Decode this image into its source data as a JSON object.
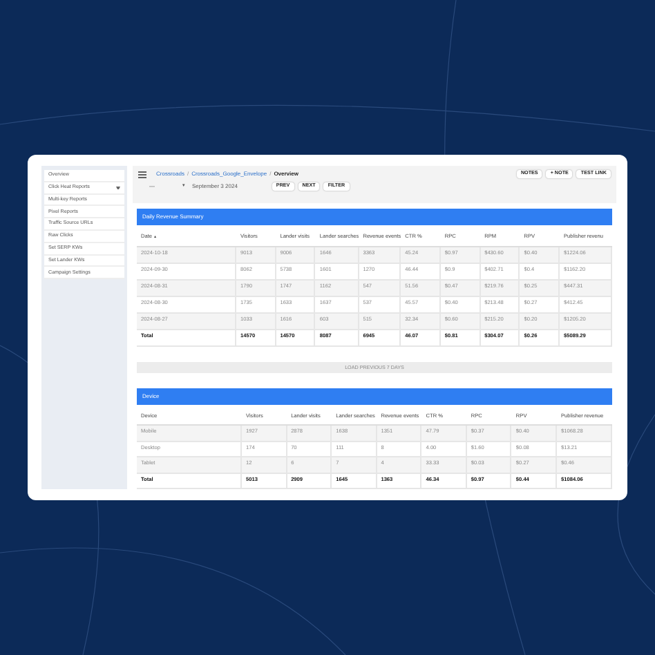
{
  "sidebar": {
    "items": [
      {
        "label": "Overview"
      },
      {
        "label": "Click Heat Reports",
        "expandable": true
      },
      {
        "label": "Multi-key Reports"
      },
      {
        "label": "Pixel Reports"
      },
      {
        "label": "Traffic Source URLs"
      },
      {
        "label": "Raw Clicks"
      },
      {
        "label": "Set SERP KWs"
      },
      {
        "label": "Set Lander KWs"
      },
      {
        "label": "Campaign Settings"
      }
    ]
  },
  "breadcrumb_separator": "/",
  "breadcrumb": [
    {
      "label": "Crossroads",
      "link": true
    },
    {
      "label": "Crossroads_Google_Envelope",
      "link": true
    },
    {
      "label": "Overview",
      "link": false
    }
  ],
  "toolbar": {
    "dash": "—",
    "caret": "▾",
    "date": "September 3 2024",
    "buttons": [
      "PREV",
      "NEXT",
      "FILTER"
    ],
    "right_buttons": [
      "NOTES",
      "+ NOTE",
      "TEST LINK"
    ]
  },
  "daily": {
    "title": "Daily Revenue Summary",
    "sort_mark": "▲",
    "columns": [
      "Date",
      "Visitors",
      "Lander visits",
      "Lander searches",
      "Revenue events",
      "CTR %",
      "RPC",
      "RPM",
      "RPV",
      "Publisher revenu"
    ],
    "rows": [
      [
        "2024-10-18",
        "9013",
        "9006",
        "1646",
        "3363",
        "45.24",
        "$0.97",
        "$430.60",
        "$0.40",
        "$1224.06"
      ],
      [
        "2024-09-30",
        "8062",
        "5738",
        "1601",
        "1270",
        "46.44",
        "$0.9",
        "$402.71",
        "$0.4",
        "$1162.20"
      ],
      [
        "2024-08-31",
        "1790",
        "1747",
        "1162",
        "547",
        "51.56",
        "$0.47",
        "$219.76",
        "$0.25",
        "$447.31"
      ],
      [
        "2024-08-30",
        "1735",
        "1633",
        "1637",
        "537",
        "45.57",
        "$0.40",
        "$213.48",
        "$0.27",
        "$412.45"
      ],
      [
        "2024-08-27",
        "1033",
        "1616",
        "603",
        "515",
        "32.34",
        "$0.60",
        "$215.20",
        "$0.20",
        "$1205.20"
      ]
    ],
    "total": [
      "Total",
      "14570",
      "14570",
      "8087",
      "6945",
      "46.07",
      "$0.81",
      "$304.07",
      "$0.26",
      "$5089.29"
    ],
    "load_button": "LOAD PREVIOUS 7 DAYS"
  },
  "device": {
    "title": "Device",
    "columns": [
      "Device",
      "Visitors",
      "Lander visits",
      "Lander searches",
      "Revenue events",
      "CTR %",
      "RPC",
      "RPV",
      "Publisher revenue"
    ],
    "rows": [
      [
        "Mobile",
        "1927",
        "2878",
        "1638",
        "1351",
        "47.79",
        "$0.37",
        "$0.40",
        "$1068.28"
      ],
      [
        "Desktop",
        "174",
        "70",
        "111",
        "8",
        "4.00",
        "$1.60",
        "$0.08",
        "$13.21"
      ],
      [
        "Tablet",
        "12",
        "6",
        "7",
        "4",
        "33.33",
        "$0.03",
        "$0.27",
        "$0.46"
      ]
    ],
    "total": [
      "Total",
      "5013",
      "2909",
      "1645",
      "1363",
      "46.34",
      "$0.97",
      "$0.44",
      "$1084.06"
    ]
  }
}
